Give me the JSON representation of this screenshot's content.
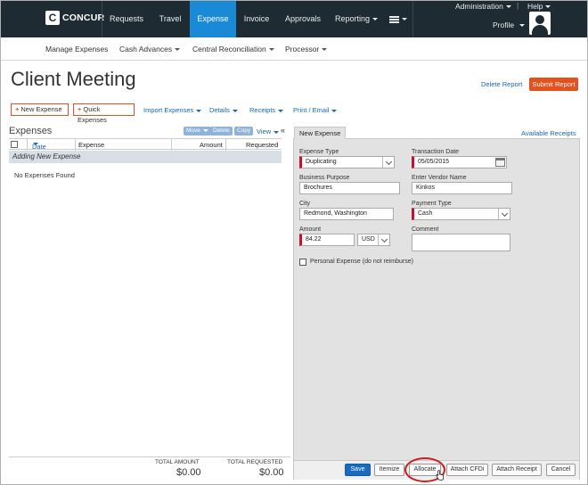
{
  "brand": {
    "logo_letter": "C",
    "name": "CONCUR"
  },
  "nav": {
    "items": [
      {
        "label": "Requests"
      },
      {
        "label": "Travel"
      },
      {
        "label": "Expense"
      },
      {
        "label": "Invoice"
      },
      {
        "label": "Approvals"
      },
      {
        "label": "Reporting"
      }
    ],
    "active": "Expense",
    "accent_color": "#1a8ad6",
    "bar_color": "#1f2b33"
  },
  "utility": {
    "administration": "Administration",
    "help": "Help",
    "profile": "Profile"
  },
  "subnav": {
    "items": [
      {
        "label": "Manage Expenses"
      },
      {
        "label": "Cash Advances"
      },
      {
        "label": "Central Reconciliation"
      },
      {
        "label": "Processor"
      }
    ]
  },
  "report": {
    "title": "Client Meeting",
    "delete_label": "Delete Report",
    "submit_label": "Submit Report",
    "submit_color": "#e1521f"
  },
  "toolbar": {
    "new_expense": "New Expense",
    "quick_expenses": "Quick Expenses",
    "import_expenses": "Import Expenses",
    "details": "Details",
    "receipts": "Receipts",
    "print_email": "Print / Email"
  },
  "expenses": {
    "title": "Expenses",
    "move": "Move",
    "delete": "Delete",
    "copy": "Copy",
    "view": "View",
    "columns": {
      "date": "Date",
      "expense": "Expense",
      "amount": "Amount",
      "requested": "Requested"
    },
    "adding_row": "Adding New Expense",
    "empty_message": "No Expenses Found",
    "total_amount_label": "TOTAL AMOUNT",
    "total_amount": "$0.00",
    "total_requested_label": "TOTAL REQUESTED",
    "total_requested": "$0.00"
  },
  "form": {
    "tab": "New Expense",
    "available_receipts": "Available Receipts",
    "expense_type": {
      "label": "Expense Type",
      "value": "Duplicating"
    },
    "transaction_date": {
      "label": "Transaction Date",
      "value": "05/05/2015"
    },
    "business_purpose": {
      "label": "Business Purpose",
      "value": "Brochures"
    },
    "vendor_name": {
      "label": "Enter Vendor Name",
      "value": "Kinkos"
    },
    "city": {
      "label": "City",
      "value": "Redmond, Washington"
    },
    "payment_type": {
      "label": "Payment Type",
      "value": "Cash"
    },
    "amount": {
      "label": "Amount",
      "value": "84.22",
      "currency": "USD"
    },
    "comment": {
      "label": "Comment",
      "value": ""
    },
    "personal_expense": {
      "label": "Personal Expense (do not reimburse)",
      "checked": false
    }
  },
  "actions": {
    "save": "Save",
    "itemize": "Itemize",
    "allocate": "Allocate",
    "attach_cfdi": "Attach CFDi",
    "attach_receipt": "Attach Receipt",
    "cancel": "Cancel",
    "highlight_color": "#d01919"
  }
}
